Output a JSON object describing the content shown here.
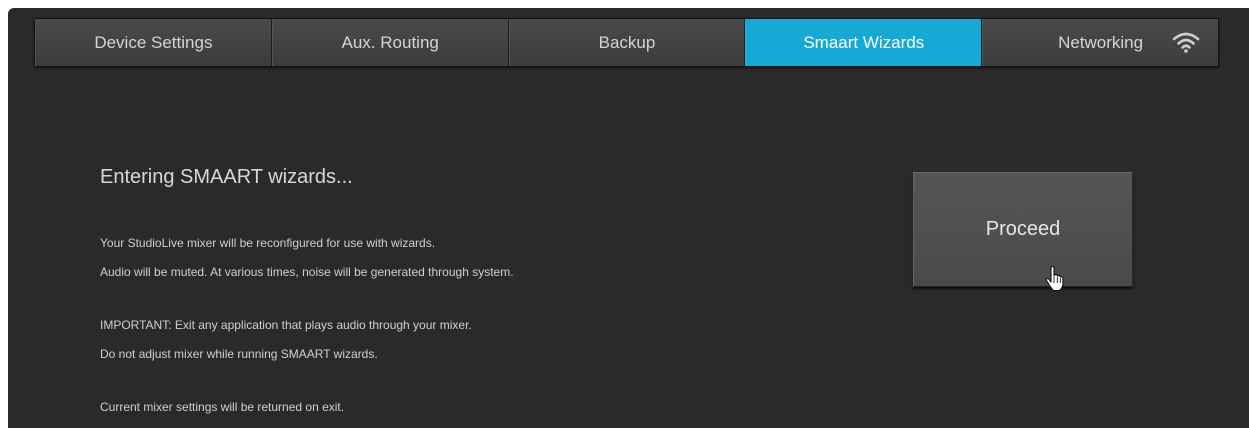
{
  "tabs": [
    {
      "label": "Device Settings",
      "active": false
    },
    {
      "label": "Aux. Routing",
      "active": false
    },
    {
      "label": "Backup",
      "active": false
    },
    {
      "label": "Smaart Wizards",
      "active": true
    },
    {
      "label": "Networking",
      "active": false,
      "icon": "wifi-icon"
    }
  ],
  "main": {
    "heading": "Entering SMAART wizards...",
    "lines_1": [
      "Your StudioLive mixer will be reconfigured for use with wizards.",
      "Audio will be muted. At various times, noise will be generated through system."
    ],
    "lines_2": [
      "IMPORTANT: Exit any application that plays audio through your mixer.",
      "Do not adjust mixer while running SMAART wizards."
    ],
    "lines_3": [
      "Current mixer settings will be returned on exit."
    ],
    "proceed_label": "Proceed"
  },
  "colors": {
    "background": "#2a2a2a",
    "active_tab": "#17a9d6",
    "tab": "#444444",
    "text": "#d0d0d0"
  },
  "cursor": "hand-pointer-icon"
}
